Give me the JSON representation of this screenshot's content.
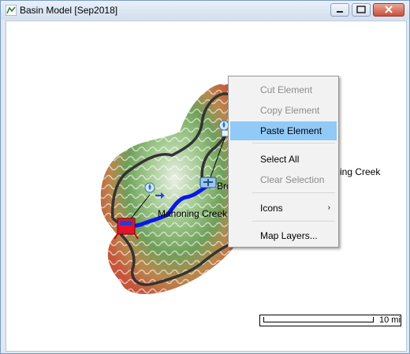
{
  "window": {
    "title": "Basin Model [Sep2018]"
  },
  "map": {
    "labels": {
      "reach": "Mahoning Creek",
      "junction": "Bro",
      "subbasin": "ing Creek"
    },
    "scale": {
      "label": "10 mi"
    }
  },
  "context_menu": {
    "items": [
      {
        "label": "Cut Element",
        "enabled": false
      },
      {
        "label": "Copy Element",
        "enabled": false
      },
      {
        "label": "Paste Element",
        "enabled": true,
        "highlighted": true
      },
      {
        "label": "Select All",
        "enabled": true
      },
      {
        "label": "Clear Selection",
        "enabled": false
      },
      {
        "label": "Icons",
        "enabled": true,
        "submenu": true
      },
      {
        "label": "Map Layers...",
        "enabled": true
      }
    ]
  },
  "colors": {
    "highlight": "#91c9f7",
    "reach": "#0b17e8",
    "boundary": "#333333",
    "reservoir": "#e8112a"
  }
}
